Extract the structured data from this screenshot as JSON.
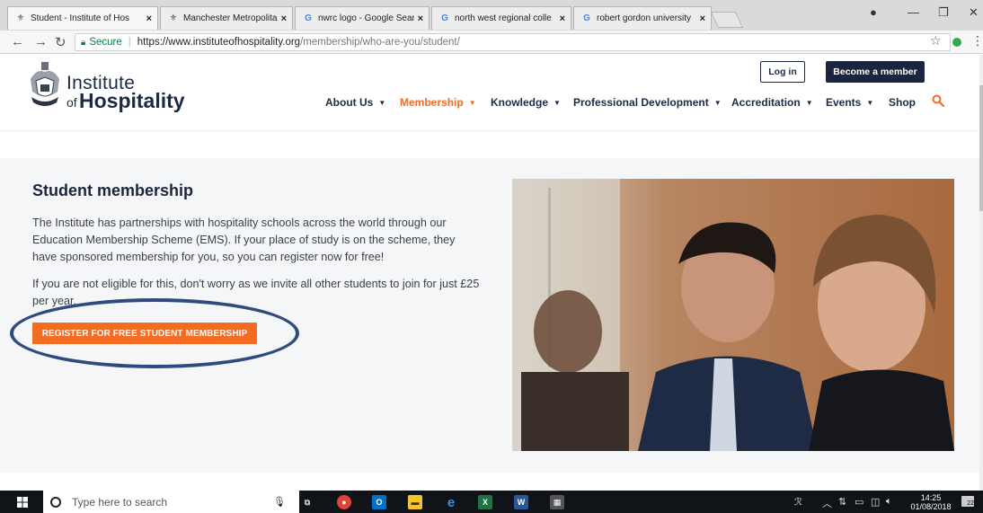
{
  "browser": {
    "tabs": [
      {
        "title": "Student - Institute of Hos",
        "icon": "crest-icon",
        "active": true
      },
      {
        "title": "Manchester Metropolitar",
        "icon": "crest-icon",
        "active": false
      },
      {
        "title": "nwrc logo - Google Searc",
        "icon": "google-icon",
        "active": false
      },
      {
        "title": "north west regional colle",
        "icon": "google-icon",
        "active": false
      },
      {
        "title": "robert gordon university",
        "icon": "google-icon",
        "active": false
      }
    ],
    "tab_close": "×",
    "address": {
      "secure_label": "Secure",
      "url_host": "https://www.instituteofhospitality.org",
      "url_path": "/membership/who-are-you/student/"
    }
  },
  "site": {
    "logo": {
      "line1": "Institute",
      "of": "of",
      "line2": "Hospitality"
    },
    "login_label": "Log in",
    "join_label": "Become a member",
    "nav": [
      {
        "label": "About Us",
        "dropdown": true
      },
      {
        "label": "Membership",
        "dropdown": true,
        "active": true
      },
      {
        "label": "Knowledge",
        "dropdown": true
      },
      {
        "label": "Professional Development",
        "dropdown": true
      },
      {
        "label": "Accreditation",
        "dropdown": true
      },
      {
        "label": "Events",
        "dropdown": true
      },
      {
        "label": "Shop",
        "dropdown": false
      }
    ],
    "accent_color": "#f36c21",
    "brand_color": "#1b2540"
  },
  "content": {
    "heading": "Student membership",
    "para1": "The Institute has partnerships with hospitality schools across the world through our Education Membership Scheme (EMS). If your place of study is on the scheme, they have sponsored membership for you, so you can register now for free!",
    "para2": "If you are not eligible for this, don't worry as we invite all other students to join for just £25 per year.",
    "cta_label": "REGISTER FOR FREE STUDENT MEMBERSHIP"
  },
  "taskbar": {
    "search_placeholder": "Type here to search",
    "time": "14:25",
    "date": "01/08/2018",
    "notification_count": "22"
  }
}
